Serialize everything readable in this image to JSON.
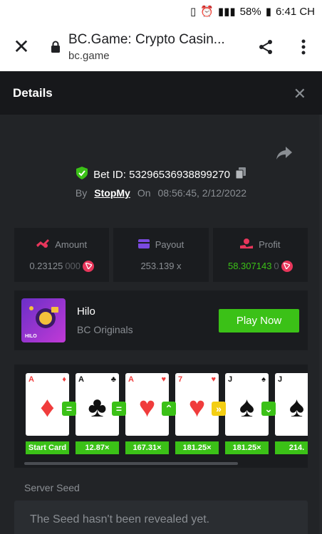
{
  "status_bar": {
    "battery": "58%",
    "time": "6:41 CH"
  },
  "browser": {
    "page_title": "BC.Game: Crypto Casin...",
    "domain": "bc.game"
  },
  "dialog": {
    "title": "Details"
  },
  "bet": {
    "id_label": "Bet ID: 53296536938899270",
    "by_label": "By",
    "user": "StopMy",
    "on_label": "On",
    "datetime": "08:56:45, 2/12/2022"
  },
  "stats": {
    "amount_label": "Amount",
    "amount_value": "0.23125",
    "amount_value_dim": "000",
    "payout_label": "Payout",
    "payout_value": "253.139 x",
    "profit_label": "Profit",
    "profit_value": "58.307143",
    "profit_value_dim": "0"
  },
  "game": {
    "name": "Hilo",
    "provider": "BC Originals",
    "thumb_tag": "HILO",
    "play_label": "Play Now"
  },
  "cards": [
    {
      "rank": "A",
      "suit": "♦",
      "color": "red",
      "mult": "Start Card",
      "op": "="
    },
    {
      "rank": "A",
      "suit": "♣",
      "color": "blk",
      "mult": "12.87×",
      "op": "="
    },
    {
      "rank": "A",
      "suit": "♥",
      "color": "red",
      "mult": "167.31×",
      "op": "^"
    },
    {
      "rank": "7",
      "suit": "♥",
      "color": "red",
      "mult": "181.25×",
      "op": "»"
    },
    {
      "rank": "J",
      "suit": "♠",
      "color": "blk",
      "mult": "181.25×",
      "op": "v"
    },
    {
      "rank": "J",
      "suit": "♠",
      "color": "blk",
      "mult": "214.",
      "op": ""
    }
  ],
  "seed": {
    "label": "Server Seed",
    "text": "The Seed hasn't been revealed yet."
  },
  "colors": {
    "accent_green": "#3bc117",
    "background": "#222427",
    "panel": "#1a1c1f"
  }
}
